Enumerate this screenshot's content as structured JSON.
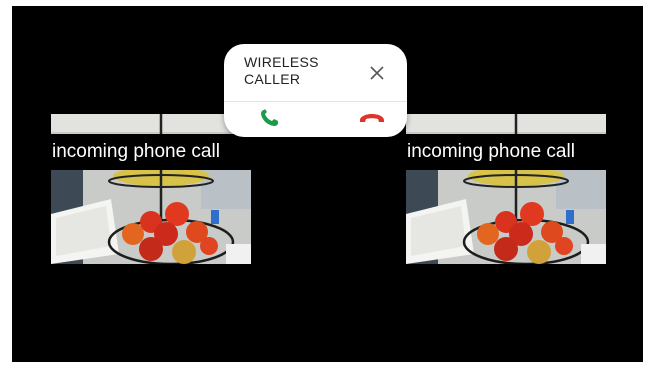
{
  "video_panels": [
    {
      "caption": "incoming phone call"
    },
    {
      "caption": "incoming phone call"
    }
  ],
  "call_notification": {
    "caller_name": "WIRELESS CALLER",
    "accept_color": "#1a9a4a",
    "decline_color": "#e0332c",
    "icons": {
      "accept": "phone-answer-icon",
      "decline": "phone-hangup-icon",
      "dismiss": "close-icon"
    }
  }
}
